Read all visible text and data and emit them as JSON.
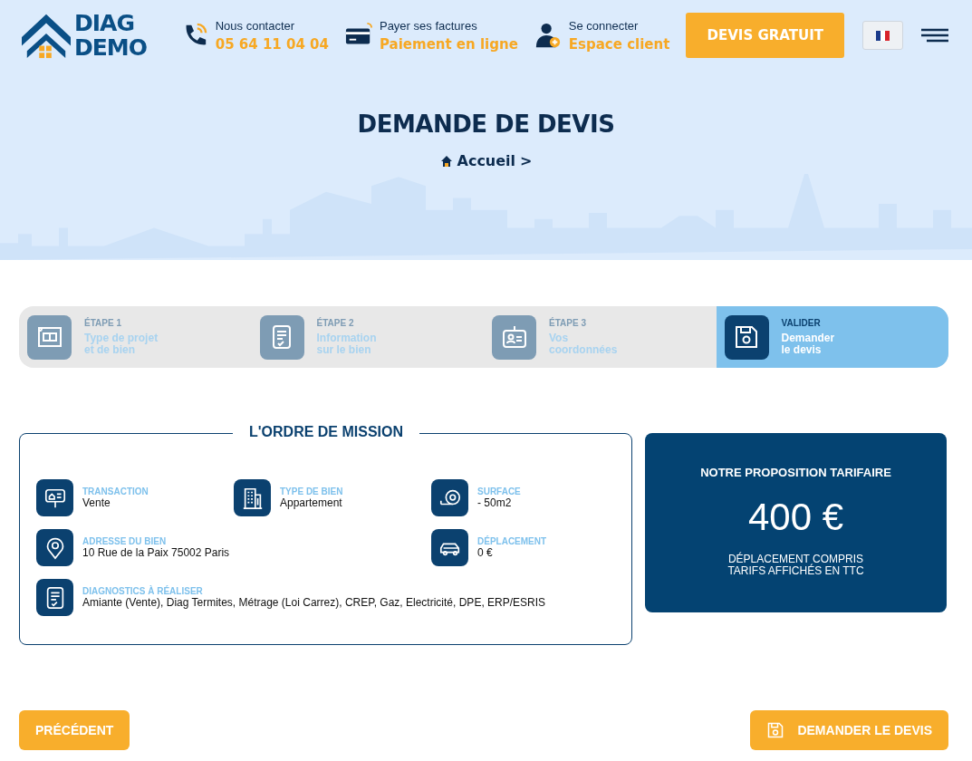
{
  "header": {
    "logo": [
      "DIAG",
      "DEMO"
    ],
    "contacts": [
      {
        "kind": "phone",
        "label": "Nous contacter",
        "value": "05 64 11 04 04"
      },
      {
        "kind": "card",
        "label": "Payer ses factures",
        "value": "Paiement en ligne"
      },
      {
        "kind": "user",
        "label": "Se connecter",
        "value": "Espace client"
      }
    ],
    "cta": "DEVIS GRATUIT"
  },
  "hero": {
    "title": "DEMANDE DE DEVIS",
    "breadcrumb": "Accueil",
    "separator": ">"
  },
  "steps": [
    {
      "kind": "plan",
      "label": "ÉTAPE 1",
      "text": [
        "Type de projet",
        "et de bien"
      ],
      "selected": false
    },
    {
      "kind": "list",
      "label": "ÉTAPE 2",
      "text": [
        "Information",
        "sur le bien"
      ],
      "selected": false
    },
    {
      "kind": "badge",
      "label": "ÉTAPE 3",
      "text": [
        "Vos",
        "coordonnées"
      ],
      "selected": false
    },
    {
      "kind": "save",
      "label": "VALIDER",
      "text": [
        "Demander",
        "le devis"
      ],
      "selected": true
    }
  ],
  "mission": {
    "title": "L'ORDRE DE MISSION",
    "rows": [
      [
        {
          "kind": "sign",
          "label": "TRANSACTION",
          "value": "Vente"
        },
        {
          "kind": "building",
          "label": "TYPE DE BIEN",
          "value": "Appartement"
        },
        {
          "kind": "tape",
          "label": "SURFACE",
          "value": "- 50m2"
        }
      ],
      [
        {
          "kind": "pin",
          "label": "ADRESSE DU BIEN",
          "value": "10 Rue de la Paix 75002 Paris"
        },
        null,
        {
          "kind": "car",
          "label": "DÉPLACEMENT",
          "value": "0 €"
        }
      ],
      [
        {
          "kind": "list",
          "label": "DIAGNOSTICS À RÉALISER",
          "value": "Amiante (Vente), Diag Termites, Métrage (Loi Carrez), CREP, Gaz, Electricité, DPE, ERP/ESRIS"
        }
      ]
    ]
  },
  "price": {
    "title": "NOTRE PROPOSITION TARIFAIRE",
    "amount": "400 €",
    "notes": [
      "DÉPLACEMENT COMPRIS",
      "TARIFS AFFICHÉS EN TTC"
    ]
  },
  "buttons": {
    "back": "PRÉCÉDENT",
    "submit": "DEMANDER LE DEVIS"
  }
}
